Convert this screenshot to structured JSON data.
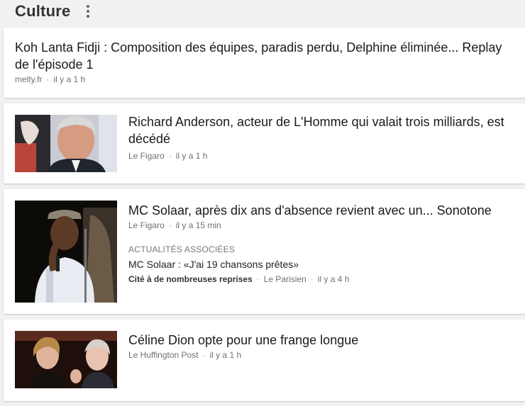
{
  "section": {
    "title": "Culture"
  },
  "articles": [
    {
      "title": "Koh Lanta Fidji : Composition des équipes, paradis perdu, Delphine éliminée... Replay de l'épisode 1",
      "source": "melty.fr",
      "time": "il y a 1 h"
    },
    {
      "title": "Richard Anderson, acteur de L'Homme qui valait trois milliards, est décédé",
      "source": "Le Figaro",
      "time": "il y a 1 h"
    },
    {
      "title": "MC Solaar, après dix ans d'absence revient avec un... Sonotone",
      "source": "Le Figaro",
      "time": "il y a 15 min",
      "related": {
        "label": "ACTUALITÉS ASSOCIÉES",
        "title": "MC Solaar : «J'ai 19 chansons prêtes»",
        "cite": "Cité à de nombreuses reprises",
        "source": "Le Parisien",
        "time": "il y a 4 h"
      }
    },
    {
      "title": "Céline Dion opte pour une frange longue",
      "source": "Le Huffington Post",
      "time": "il y a 1 h"
    }
  ]
}
